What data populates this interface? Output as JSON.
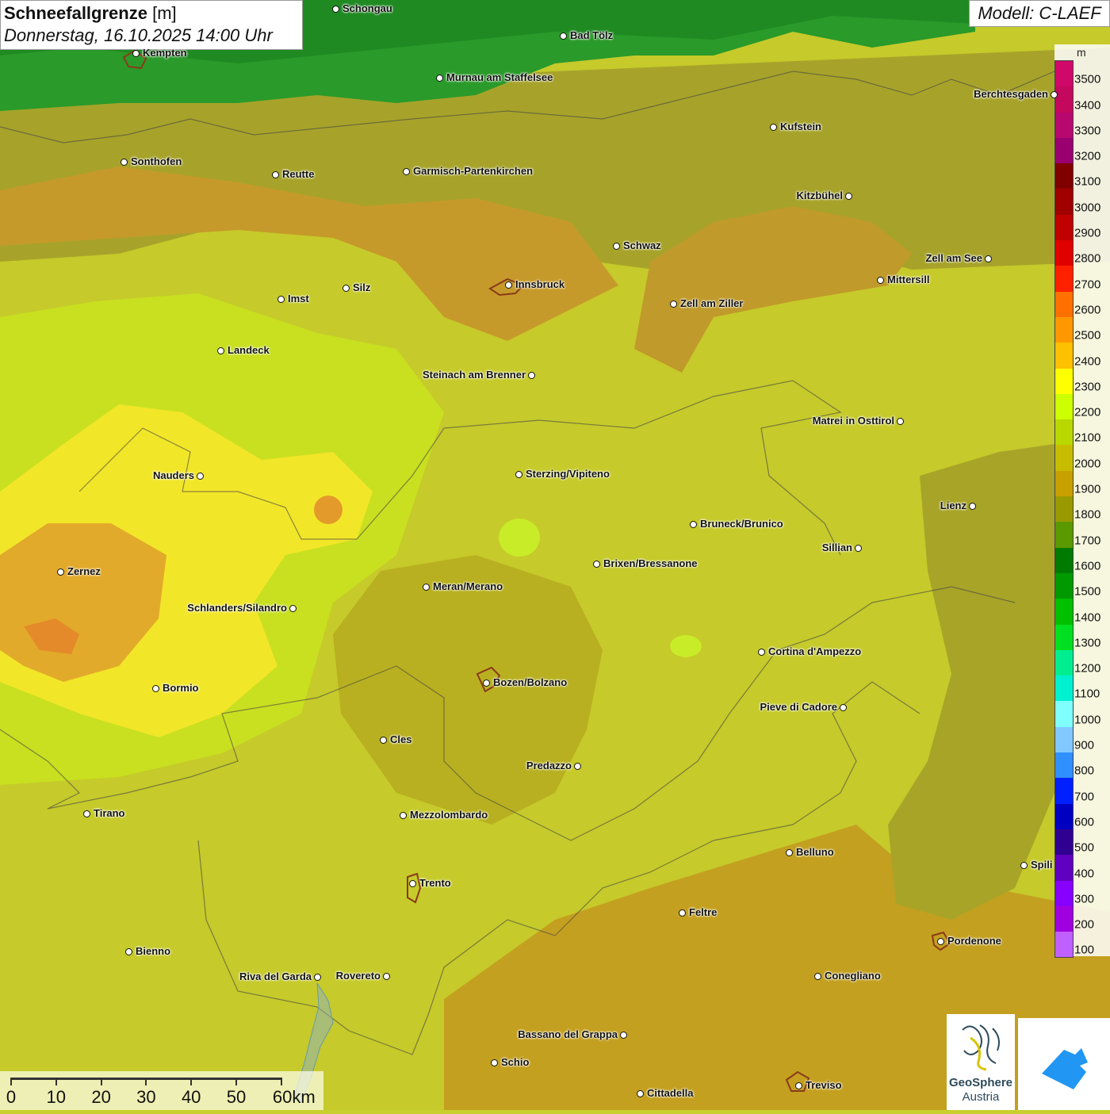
{
  "header": {
    "title_bold": "Schneefallgrenze",
    "title_unit": "[m]",
    "datetime": "Donnerstag, 16.10.2025 14:00 Uhr",
    "model": "Modell: C-LAEF"
  },
  "legend": {
    "unit": "m",
    "items": [
      {
        "label": "3500",
        "color": "#d0086a"
      },
      {
        "label": "3400",
        "color": "#c4085e"
      },
      {
        "label": "3300",
        "color": "#b80870"
      },
      {
        "label": "3200",
        "color": "#9a0070"
      },
      {
        "label": "3100",
        "color": "#800000"
      },
      {
        "label": "3000",
        "color": "#a00000"
      },
      {
        "label": "2900",
        "color": "#c00000"
      },
      {
        "label": "2800",
        "color": "#e00000"
      },
      {
        "label": "2700",
        "color": "#ff2000"
      },
      {
        "label": "2600",
        "color": "#ff7000"
      },
      {
        "label": "2500",
        "color": "#ff9800"
      },
      {
        "label": "2400",
        "color": "#ffc000"
      },
      {
        "label": "2300",
        "color": "#ffff00"
      },
      {
        "label": "2200",
        "color": "#ccff00"
      },
      {
        "label": "2100",
        "color": "#b8d800"
      },
      {
        "label": "2000",
        "color": "#c8bc00"
      },
      {
        "label": "1900",
        "color": "#c8a000"
      },
      {
        "label": "1800",
        "color": "#9a9a00"
      },
      {
        "label": "1700",
        "color": "#5a9a00"
      },
      {
        "label": "1600",
        "color": "#007a00"
      },
      {
        "label": "1500",
        "color": "#009a00"
      },
      {
        "label": "1400",
        "color": "#00c000"
      },
      {
        "label": "1300",
        "color": "#00e020"
      },
      {
        "label": "1200",
        "color": "#00ee90"
      },
      {
        "label": "1100",
        "color": "#00f0d0"
      },
      {
        "label": "1000",
        "color": "#80ffff"
      },
      {
        "label": "900",
        "color": "#80c8ff"
      },
      {
        "label": "800",
        "color": "#3090ff"
      },
      {
        "label": "700",
        "color": "#0020ff"
      },
      {
        "label": "600",
        "color": "#0000c0"
      },
      {
        "label": "500",
        "color": "#300090"
      },
      {
        "label": "400",
        "color": "#6000c0"
      },
      {
        "label": "300",
        "color": "#8800ff"
      },
      {
        "label": "200",
        "color": "#a000e0"
      },
      {
        "label": "100",
        "color": "#c060ff"
      }
    ]
  },
  "cities": [
    {
      "name": "Schongau"
    },
    {
      "name": "Bad Tölz"
    },
    {
      "name": "Kempten"
    },
    {
      "name": "Murnau am Staffelsee"
    },
    {
      "name": "Berchtesgaden"
    },
    {
      "name": "Kufstein"
    },
    {
      "name": "Sonthofen"
    },
    {
      "name": "Reutte"
    },
    {
      "name": "Garmisch-Partenkirchen"
    },
    {
      "name": "Kitzbühel"
    },
    {
      "name": "Schwaz"
    },
    {
      "name": "Zell am See"
    },
    {
      "name": "Mittersill"
    },
    {
      "name": "Innsbruck"
    },
    {
      "name": "Imst"
    },
    {
      "name": "Silz"
    },
    {
      "name": "Zell am Ziller"
    },
    {
      "name": "Landeck"
    },
    {
      "name": "Steinach am Brenner"
    },
    {
      "name": "Matrei in Osttirol"
    },
    {
      "name": "Nauders"
    },
    {
      "name": "Sterzing/Vipiteno"
    },
    {
      "name": "Lienz"
    },
    {
      "name": "Bruneck/Brunico"
    },
    {
      "name": "Sillian"
    },
    {
      "name": "Brixen/Bressanone"
    },
    {
      "name": "Zernez"
    },
    {
      "name": "Meran/Merano"
    },
    {
      "name": "Schlanders/Silandro"
    },
    {
      "name": "Cortina d'Ampezzo"
    },
    {
      "name": "Bozen/Bolzano"
    },
    {
      "name": "Bormio"
    },
    {
      "name": "Pieve di Cadore"
    },
    {
      "name": "Cles"
    },
    {
      "name": "Predazzo"
    },
    {
      "name": "Tirano"
    },
    {
      "name": "Mezzolombardo"
    },
    {
      "name": "Belluno"
    },
    {
      "name": "Spili"
    },
    {
      "name": "Trento"
    },
    {
      "name": "Feltre"
    },
    {
      "name": "Pordenone"
    },
    {
      "name": "Bienno"
    },
    {
      "name": "Riva del Garda"
    },
    {
      "name": "Rovereto"
    },
    {
      "name": "Conegliano"
    },
    {
      "name": "Bassano del Grappa"
    },
    {
      "name": "Schio"
    },
    {
      "name": "Treviso"
    },
    {
      "name": "Cittadella"
    }
  ],
  "scalebar": {
    "ticks": [
      "0",
      "10",
      "20",
      "30",
      "40",
      "50",
      "60km"
    ]
  },
  "logos": {
    "geosphere_line1": "GeoSphere",
    "geosphere_line2": "Austria"
  }
}
